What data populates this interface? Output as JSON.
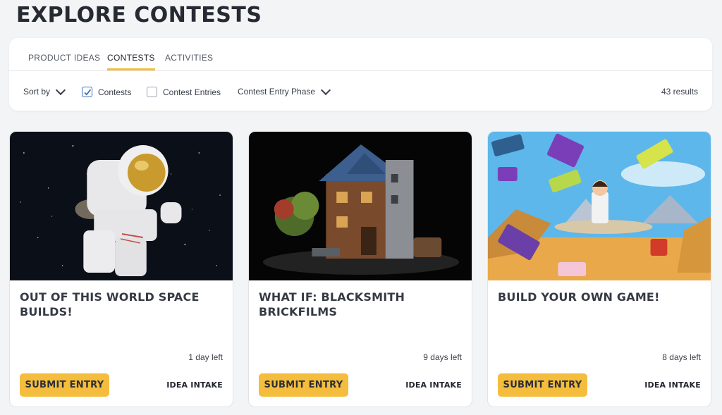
{
  "page": {
    "title": "EXPLORE CONTESTS"
  },
  "tabs": [
    {
      "label": "PRODUCT IDEAS",
      "active": false
    },
    {
      "label": "CONTESTS",
      "active": true
    },
    {
      "label": "ACTIVITIES",
      "active": false
    }
  ],
  "filters": {
    "sort_label": "Sort by",
    "contests_label": "Contests",
    "contests_checked": true,
    "entries_label": "Contest Entries",
    "entries_checked": false,
    "phase_label": "Contest Entry Phase",
    "results": "43 results"
  },
  "cards": [
    {
      "title": "OUT OF THIS WORLD SPACE BUILDS!",
      "time_left": "1 day left",
      "button": "SUBMIT ENTRY",
      "phase": "IDEA INTAKE",
      "image": "astronaut-minifigure"
    },
    {
      "title": "WHAT IF: BLACKSMITH BRICKFILMS",
      "time_left": "9 days left",
      "button": "SUBMIT ENTRY",
      "phase": "IDEA INTAKE",
      "image": "blacksmith-shop-set"
    },
    {
      "title": "BUILD YOUR OWN GAME!",
      "time_left": "8 days left",
      "button": "SUBMIT ENTRY",
      "phase": "IDEA INTAKE",
      "image": "game-bricks-scene"
    }
  ],
  "colors": {
    "accent": "#f5bd3d",
    "checkbox": "#3b6fb6"
  }
}
